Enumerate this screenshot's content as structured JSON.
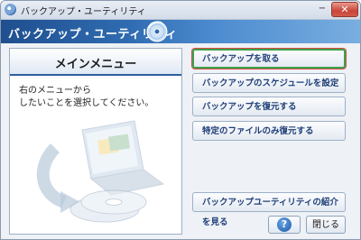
{
  "window": {
    "title": "バックアップ・ユーティリティ",
    "minimize_glyph": "−",
    "close_glyph": "✕"
  },
  "banner": {
    "title": "バックアップ・ユーティリティ"
  },
  "left_panel": {
    "menu_title": "メインメニュー",
    "instruction_line1": "右のメニューから",
    "instruction_line2": "したいことを選択してください。"
  },
  "actions": [
    {
      "label": "バックアップを取る",
      "selected": true
    },
    {
      "label": "バックアップのスケジュールを設定する",
      "selected": false
    },
    {
      "label": "バックアップを復元する",
      "selected": false
    },
    {
      "label": "特定のファイルのみ復元する",
      "selected": false
    }
  ],
  "footer": {
    "intro_button": "バックアップユーティリティの紹介を見る",
    "help_glyph": "?",
    "close_button": "閉じる"
  },
  "colors": {
    "banner_dark": "#1f4f8f",
    "banner_light": "#79aee0",
    "button_text": "#1f3f78",
    "selected_border": "#3aa24a",
    "selected_outline": "#e04848"
  },
  "icons": [
    "app-disc-icon",
    "banner-disc-icon",
    "backup-laptop-illustration",
    "help-icon"
  ]
}
